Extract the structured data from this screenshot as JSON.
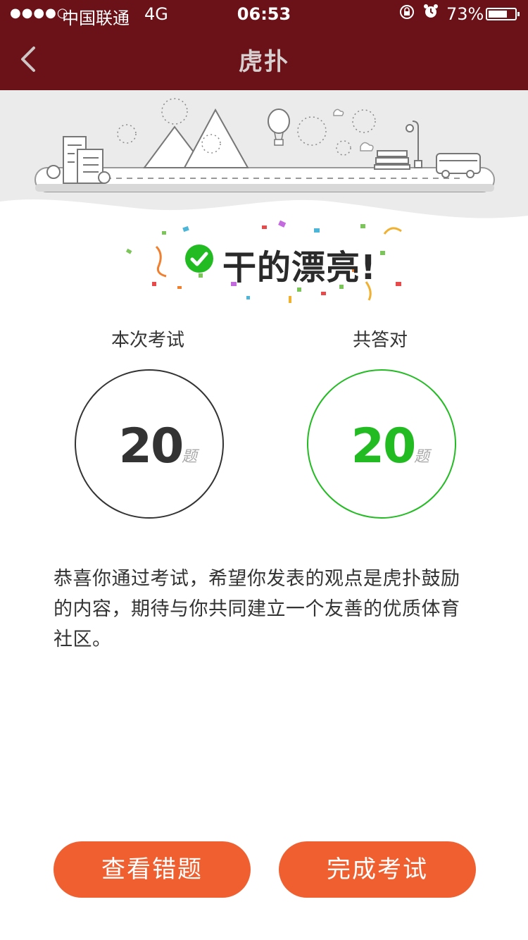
{
  "status_bar": {
    "signal": "●●●●○",
    "carrier": "中国联通",
    "network": "4G",
    "time": "06:53",
    "battery_percent": "73%",
    "battery_level": 0.73,
    "icons": [
      "orientation-lock-icon",
      "alarm-icon",
      "battery-icon"
    ]
  },
  "nav": {
    "title": "虎扑",
    "back_icon": "chevron-left-icon"
  },
  "result": {
    "headline": "干的漂亮!",
    "headline_icon": "check-circle-icon"
  },
  "stats": {
    "total": {
      "label": "本次考试",
      "value": "20",
      "unit": "题"
    },
    "correct": {
      "label": "共答对",
      "value": "20",
      "unit": "题"
    }
  },
  "message": "恭喜你通过考试，希望你发表的观点是虎扑鼓励的内容，期待与你共同建立一个友善的优质体育社区。",
  "buttons": {
    "review_wrong": "查看错题",
    "finish": "完成考试"
  },
  "colors": {
    "header_bg": "#6b1118",
    "accent_orange": "#f05f30",
    "success_green": "#22bb22",
    "total_circle": "#333333"
  }
}
